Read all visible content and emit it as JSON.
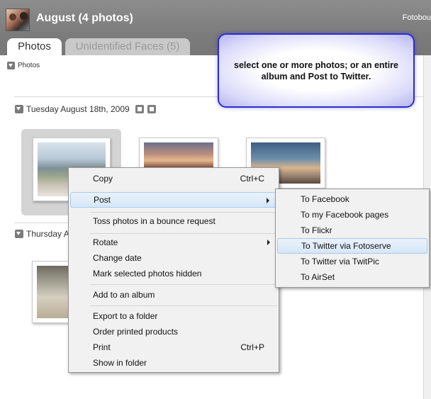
{
  "header": {
    "album_title": "August (4 photos)",
    "brand": "Fotobou"
  },
  "tabs": [
    {
      "label": "Photos",
      "active": true
    },
    {
      "label": "Unidentified Faces (5)",
      "active": false
    }
  ],
  "section": {
    "label": "Photos"
  },
  "groups": [
    {
      "date": "Tuesday August 18th, 2009"
    },
    {
      "date": "Thursday A"
    }
  ],
  "callout": {
    "text": "select one or more photos; or an entire album and Post to Twitter."
  },
  "context_menu": {
    "items": [
      {
        "label": "Copy",
        "shortcut": "Ctrl+C"
      },
      {
        "label": "Post",
        "submenu": true
      },
      {
        "label": "Toss photos in a bounce request"
      },
      {
        "label": "Rotate",
        "submenu": true
      },
      {
        "label": "Change date"
      },
      {
        "label": "Mark selected photos hidden"
      },
      {
        "label": "Add to an album"
      },
      {
        "label": "Export to a folder"
      },
      {
        "label": "Order printed products"
      },
      {
        "label": "Print",
        "shortcut": "Ctrl+P"
      },
      {
        "label": "Show in folder"
      }
    ]
  },
  "submenu": {
    "items": [
      {
        "label": "To Facebook"
      },
      {
        "label": "To my Facebook pages"
      },
      {
        "label": "To Flickr"
      },
      {
        "label": "To Twitter via Fotoserve"
      },
      {
        "label": "To Twitter via TwitPic"
      },
      {
        "label": "To AirSet"
      }
    ]
  },
  "colors": {
    "header_bg": "#808080",
    "callout_border": "#2b2bd6",
    "menu_highlight": "#d6e7f8"
  }
}
